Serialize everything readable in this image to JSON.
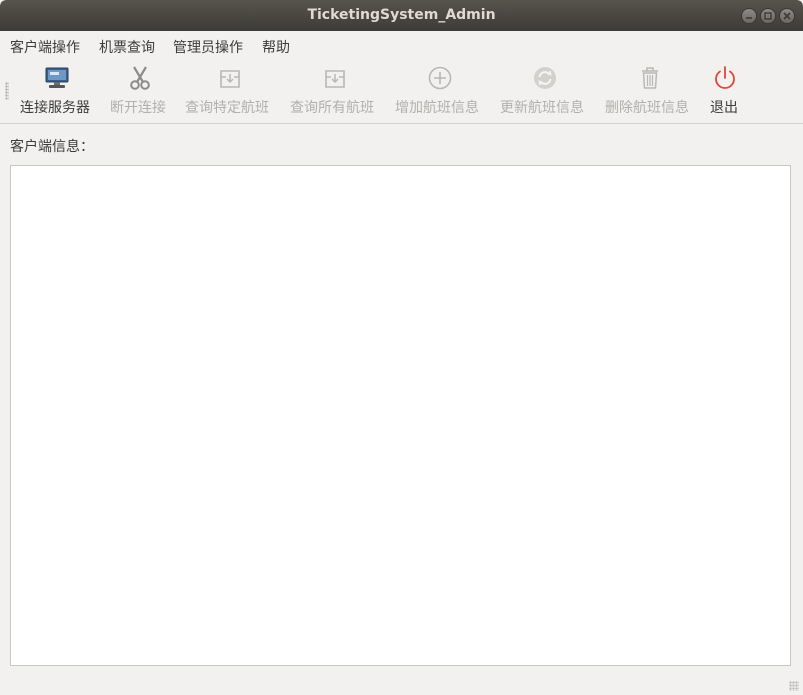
{
  "window": {
    "title": "TicketingSystem_Admin"
  },
  "menu": [
    {
      "label": "客户端操作"
    },
    {
      "label": "机票查询"
    },
    {
      "label": "管理员操作"
    },
    {
      "label": "帮助"
    }
  ],
  "toolbar": {
    "connect": "连接服务器",
    "disconnect": "断开连接",
    "query_specific": "查询特定航班",
    "query_all": "查询所有航班",
    "add_flight": "增加航班信息",
    "update_flight": "更新航班信息",
    "delete_flight": "删除航班信息",
    "exit": "退出"
  },
  "content": {
    "info_label": "客户端信息：",
    "info_text": ""
  },
  "colors": {
    "titlebar": "#3d3b37",
    "exit_icon": "#e0453a",
    "disabled_text": "#b2b0ad"
  }
}
